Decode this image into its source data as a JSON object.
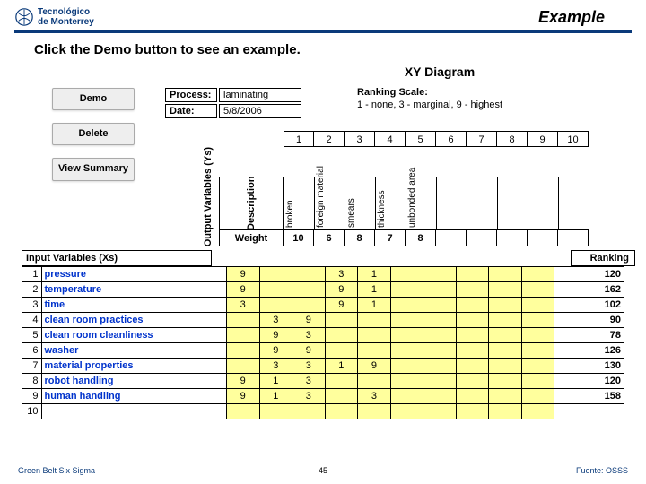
{
  "header": {
    "logo_top": "Tecnológico",
    "logo_bottom": "de Monterrey",
    "title": "Example"
  },
  "instruction": "Click the Demo button to see an example.",
  "buttons": {
    "demo": "Demo",
    "delete": "Delete",
    "view": "View Summary"
  },
  "chart": {
    "title": "XY Diagram",
    "process_label": "Process:",
    "process_value": "laminating",
    "date_label": "Date:",
    "date_value": "5/8/2006",
    "scale_title": "Ranking Scale:",
    "scale_text": "1 - none, 3 - marginal, 9 - highest",
    "y_axis": "Output Variables (Ys)",
    "desc_label": "Description",
    "weight_label": "Weight",
    "nums": [
      "1",
      "2",
      "3",
      "4",
      "5",
      "6",
      "7",
      "8",
      "9",
      "10"
    ],
    "vheads": [
      "broken",
      "foreign material",
      "smears",
      "thickness",
      "unbonded area",
      "",
      "",
      "",
      "",
      ""
    ],
    "weights": [
      "10",
      "6",
      "8",
      "7",
      "8",
      "",
      "",
      "",
      "",
      ""
    ],
    "input_label": "Input Variables (Xs)",
    "ranking_label": "Ranking"
  },
  "rows": [
    {
      "n": "1",
      "name": "pressure",
      "c": [
        "9",
        "",
        "",
        "3",
        "1",
        "",
        "",
        "",
        "",
        ""
      ],
      "r": "120"
    },
    {
      "n": "2",
      "name": "temperature",
      "c": [
        "9",
        "",
        "",
        "9",
        "1",
        "",
        "",
        "",
        "",
        ""
      ],
      "r": "162"
    },
    {
      "n": "3",
      "name": "time",
      "c": [
        "3",
        "",
        "",
        "9",
        "1",
        "",
        "",
        "",
        "",
        ""
      ],
      "r": "102"
    },
    {
      "n": "4",
      "name": "clean room practices",
      "c": [
        "",
        "3",
        "9",
        "",
        "",
        "",
        "",
        "",
        "",
        ""
      ],
      "r": "90"
    },
    {
      "n": "5",
      "name": "clean room cleanliness",
      "c": [
        "",
        "9",
        "3",
        "",
        "",
        "",
        "",
        "",
        "",
        ""
      ],
      "r": "78"
    },
    {
      "n": "6",
      "name": "washer",
      "c": [
        "",
        "9",
        "9",
        "",
        "",
        "",
        "",
        "",
        "",
        ""
      ],
      "r": "126"
    },
    {
      "n": "7",
      "name": "material properties",
      "c": [
        "",
        "3",
        "3",
        "1",
        "9",
        "",
        "",
        "",
        "",
        ""
      ],
      "r": "130"
    },
    {
      "n": "8",
      "name": "robot handling",
      "c": [
        "9",
        "1",
        "3",
        "",
        "",
        "",
        "",
        "",
        "",
        ""
      ],
      "r": "120"
    },
    {
      "n": "9",
      "name": "human handling",
      "c": [
        "9",
        "1",
        "3",
        "",
        "3",
        "",
        "",
        "",
        "",
        ""
      ],
      "r": "158"
    },
    {
      "n": "10",
      "name": "",
      "c": [
        "",
        "",
        "",
        "",
        "",
        "",
        "",
        "",
        "",
        ""
      ],
      "r": ""
    }
  ],
  "footer": {
    "left": "Green Belt Six Sigma",
    "page": "45",
    "right": "Fuente: OSSS"
  },
  "chart_data": {
    "type": "table",
    "title": "XY Diagram",
    "output_variables": [
      {
        "name": "broken",
        "weight": 10
      },
      {
        "name": "foreign material",
        "weight": 6
      },
      {
        "name": "smears",
        "weight": 8
      },
      {
        "name": "thickness",
        "weight": 7
      },
      {
        "name": "unbonded area",
        "weight": 8
      }
    ],
    "input_variables": [
      {
        "name": "pressure",
        "scores": [
          9,
          null,
          null,
          3,
          1
        ],
        "ranking": 120
      },
      {
        "name": "temperature",
        "scores": [
          9,
          null,
          null,
          9,
          1
        ],
        "ranking": 162
      },
      {
        "name": "time",
        "scores": [
          3,
          null,
          null,
          9,
          1
        ],
        "ranking": 102
      },
      {
        "name": "clean room practices",
        "scores": [
          null,
          3,
          9,
          null,
          null
        ],
        "ranking": 90
      },
      {
        "name": "clean room cleanliness",
        "scores": [
          null,
          9,
          3,
          null,
          null
        ],
        "ranking": 78
      },
      {
        "name": "washer",
        "scores": [
          null,
          9,
          9,
          null,
          null
        ],
        "ranking": 126
      },
      {
        "name": "material properties",
        "scores": [
          null,
          3,
          3,
          1,
          9
        ],
        "ranking": 130
      },
      {
        "name": "robot handling",
        "scores": [
          9,
          1,
          3,
          null,
          null
        ],
        "ranking": 120
      },
      {
        "name": "human handling",
        "scores": [
          9,
          1,
          3,
          null,
          3
        ],
        "ranking": 158
      }
    ],
    "ranking_scale": "1 - none, 3 - marginal, 9 - highest",
    "process": "laminating",
    "date": "5/8/2006"
  }
}
